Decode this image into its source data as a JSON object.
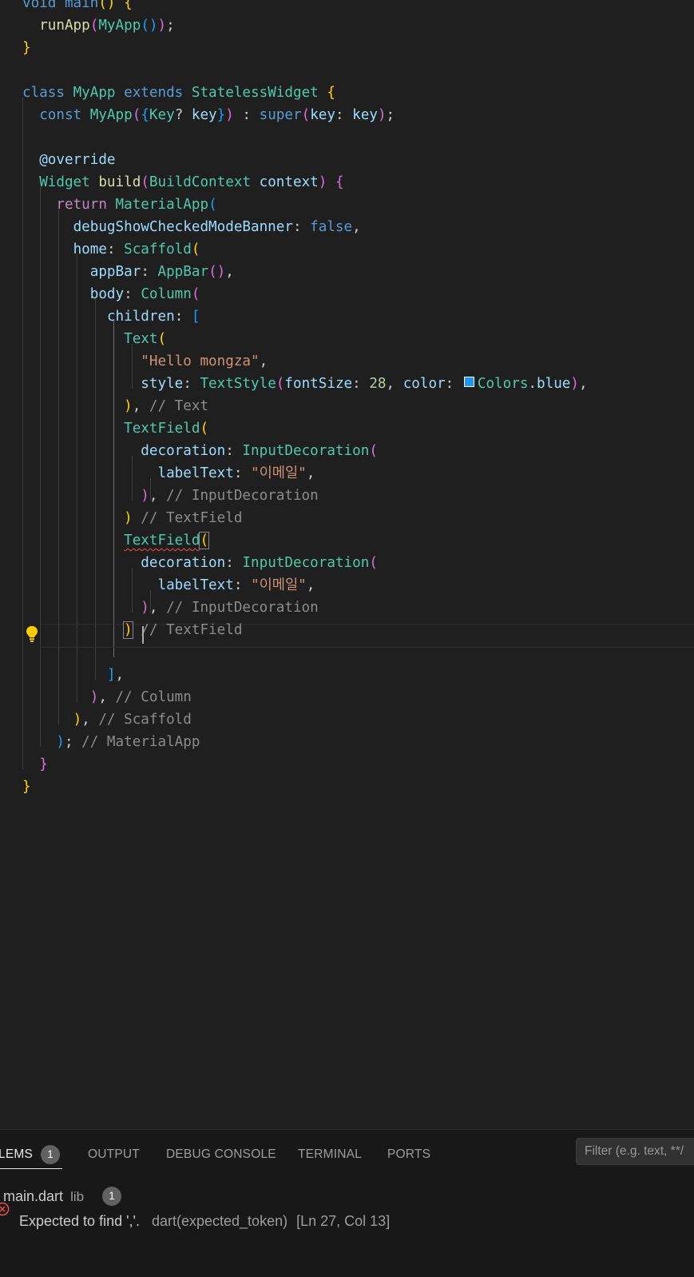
{
  "editor": {
    "lines": [
      [
        {
          "t": "void main",
          "c": "k"
        },
        {
          "t": "() ",
          "c": "b1"
        },
        {
          "t": "{",
          "c": "b1"
        }
      ],
      [
        {
          "t": "  "
        },
        {
          "t": "runApp",
          "c": "f"
        },
        {
          "t": "(",
          "c": "b2"
        },
        {
          "t": "MyApp",
          "c": "t"
        },
        {
          "t": "()",
          "c": "b3"
        },
        {
          "t": ")",
          "c": "b2"
        },
        {
          "t": ";",
          "c": "p"
        }
      ],
      [
        {
          "t": "}",
          "c": "b1"
        }
      ],
      [],
      [
        {
          "t": "class ",
          "c": "k"
        },
        {
          "t": "MyApp ",
          "c": "t"
        },
        {
          "t": "extends ",
          "c": "k"
        },
        {
          "t": "StatelessWidget ",
          "c": "t"
        },
        {
          "t": "{",
          "c": "b1"
        }
      ],
      [
        {
          "t": "  "
        },
        {
          "t": "const ",
          "c": "k"
        },
        {
          "t": "MyApp",
          "c": "t"
        },
        {
          "t": "(",
          "c": "b2"
        },
        {
          "t": "{",
          "c": "b3"
        },
        {
          "t": "Key",
          "c": "t"
        },
        {
          "t": "? ",
          "c": "p"
        },
        {
          "t": "key",
          "c": "v"
        },
        {
          "t": "}",
          "c": "b3"
        },
        {
          "t": ")",
          "c": "b2"
        },
        {
          "t": " : ",
          "c": "p"
        },
        {
          "t": "super",
          "c": "k"
        },
        {
          "t": "(",
          "c": "b2"
        },
        {
          "t": "key",
          "c": "v"
        },
        {
          "t": ": ",
          "c": "p"
        },
        {
          "t": "key",
          "c": "v"
        },
        {
          "t": ")",
          "c": "b2"
        },
        {
          "t": ";",
          "c": "p"
        }
      ],
      [],
      [
        {
          "t": "  "
        },
        {
          "t": "@override",
          "c": "v"
        }
      ],
      [
        {
          "t": "  "
        },
        {
          "t": "Widget ",
          "c": "t"
        },
        {
          "t": "build",
          "c": "f"
        },
        {
          "t": "(",
          "c": "b2"
        },
        {
          "t": "BuildContext ",
          "c": "t"
        },
        {
          "t": "context",
          "c": "v"
        },
        {
          "t": ") ",
          "c": "b2"
        },
        {
          "t": "{",
          "c": "b2"
        }
      ],
      [
        {
          "t": "    "
        },
        {
          "t": "return ",
          "c": "c"
        },
        {
          "t": "MaterialApp",
          "c": "t"
        },
        {
          "t": "(",
          "c": "b3"
        }
      ],
      [
        {
          "t": "      "
        },
        {
          "t": "debugShowCheckedModeBanner",
          "c": "v"
        },
        {
          "t": ": ",
          "c": "p"
        },
        {
          "t": "false",
          "c": "k"
        },
        {
          "t": ",",
          "c": "p"
        }
      ],
      [
        {
          "t": "      "
        },
        {
          "t": "home",
          "c": "v"
        },
        {
          "t": ": ",
          "c": "p"
        },
        {
          "t": "Scaffold",
          "c": "t"
        },
        {
          "t": "(",
          "c": "b1"
        }
      ],
      [
        {
          "t": "        "
        },
        {
          "t": "appBar",
          "c": "v"
        },
        {
          "t": ": ",
          "c": "p"
        },
        {
          "t": "AppBar",
          "c": "t"
        },
        {
          "t": "()",
          "c": "b2"
        },
        {
          "t": ",",
          "c": "p"
        }
      ],
      [
        {
          "t": "        "
        },
        {
          "t": "body",
          "c": "v"
        },
        {
          "t": ": ",
          "c": "p"
        },
        {
          "t": "Column",
          "c": "t"
        },
        {
          "t": "(",
          "c": "b2"
        }
      ],
      [
        {
          "t": "          "
        },
        {
          "t": "children",
          "c": "v"
        },
        {
          "t": ": ",
          "c": "p"
        },
        {
          "t": "[",
          "c": "b3"
        }
      ],
      [
        {
          "t": "            "
        },
        {
          "t": "Text",
          "c": "t"
        },
        {
          "t": "(",
          "c": "b1"
        }
      ],
      [
        {
          "t": "              "
        },
        {
          "t": "\"Hello mongza\"",
          "c": "s"
        },
        {
          "t": ",",
          "c": "p"
        }
      ],
      [
        {
          "t": "              "
        },
        {
          "t": "style",
          "c": "v"
        },
        {
          "t": ": ",
          "c": "p"
        },
        {
          "t": "TextStyle",
          "c": "t"
        },
        {
          "t": "(",
          "c": "b2"
        },
        {
          "t": "fontSize",
          "c": "v"
        },
        {
          "t": ": ",
          "c": "p"
        },
        {
          "t": "28",
          "c": "n"
        },
        {
          "t": ", ",
          "c": "p"
        },
        {
          "t": "color",
          "c": "v"
        },
        {
          "t": ": ",
          "c": "p"
        },
        {
          "t": "",
          "swatch": true
        },
        {
          "t": "Colors",
          "c": "t"
        },
        {
          "t": ".",
          "c": "p"
        },
        {
          "t": "blue",
          "c": "v"
        },
        {
          "t": ")",
          "c": "b2"
        },
        {
          "t": ",",
          "c": "p"
        }
      ],
      [
        {
          "t": "            "
        },
        {
          "t": ")",
          "c": "b1"
        },
        {
          "t": ", ",
          "c": "p"
        },
        {
          "t": "// Text",
          "c": "cm"
        }
      ],
      [
        {
          "t": "            "
        },
        {
          "t": "TextField",
          "c": "t"
        },
        {
          "t": "(",
          "c": "b1"
        }
      ],
      [
        {
          "t": "              "
        },
        {
          "t": "decoration",
          "c": "v"
        },
        {
          "t": ": ",
          "c": "p"
        },
        {
          "t": "InputDecoration",
          "c": "t"
        },
        {
          "t": "(",
          "c": "b2"
        }
      ],
      [
        {
          "t": "                "
        },
        {
          "t": "labelText",
          "c": "v"
        },
        {
          "t": ": ",
          "c": "p"
        },
        {
          "t": "\"이메일\"",
          "c": "s"
        },
        {
          "t": ",",
          "c": "p"
        }
      ],
      [
        {
          "t": "              "
        },
        {
          "t": ")",
          "c": "b2"
        },
        {
          "t": ", ",
          "c": "p"
        },
        {
          "t": "// InputDecoration",
          "c": "cm"
        }
      ],
      [
        {
          "t": "            "
        },
        {
          "t": ")",
          "c": "b1"
        },
        {
          "t": " "
        },
        {
          "t": "// TextField",
          "c": "cm"
        }
      ],
      [
        {
          "t": "            "
        },
        {
          "t": "TextField",
          "c": "t",
          "sq": true
        },
        {
          "t": "(",
          "c": "b1",
          "bm": true
        }
      ],
      [
        {
          "t": "              "
        },
        {
          "t": "decoration",
          "c": "v"
        },
        {
          "t": ": ",
          "c": "p"
        },
        {
          "t": "InputDecoration",
          "c": "t"
        },
        {
          "t": "(",
          "c": "b2"
        }
      ],
      [
        {
          "t": "                "
        },
        {
          "t": "labelText",
          "c": "v"
        },
        {
          "t": ": ",
          "c": "p"
        },
        {
          "t": "\"이메일\"",
          "c": "s"
        },
        {
          "t": ",",
          "c": "p"
        }
      ],
      [
        {
          "t": "              "
        },
        {
          "t": ")",
          "c": "b2"
        },
        {
          "t": ", ",
          "c": "p"
        },
        {
          "t": "// InputDecoration",
          "c": "cm"
        }
      ],
      [
        {
          "t": "            "
        },
        {
          "t": ")",
          "c": "b1",
          "bm": true
        },
        {
          "t": " "
        },
        {
          "t": "// TextField",
          "c": "cm"
        }
      ],
      [],
      [
        {
          "t": "          "
        },
        {
          "t": "]",
          "c": "b3"
        },
        {
          "t": ",",
          "c": "p"
        }
      ],
      [
        {
          "t": "        "
        },
        {
          "t": ")",
          "c": "b2"
        },
        {
          "t": ", ",
          "c": "p"
        },
        {
          "t": "// Column",
          "c": "cm"
        }
      ],
      [
        {
          "t": "      "
        },
        {
          "t": ")",
          "c": "b1"
        },
        {
          "t": ", ",
          "c": "p"
        },
        {
          "t": "// Scaffold",
          "c": "cm"
        }
      ],
      [
        {
          "t": "    "
        },
        {
          "t": ")",
          "c": "b3"
        },
        {
          "t": "; ",
          "c": "p"
        },
        {
          "t": "// MaterialApp",
          "c": "cm"
        }
      ],
      [
        {
          "t": "  "
        },
        {
          "t": "}",
          "c": "b2"
        }
      ],
      [
        {
          "t": "}",
          "c": "b1"
        }
      ]
    ]
  },
  "panel": {
    "tabs": {
      "problems": "LEMS",
      "problems_count": "1",
      "output": "OUTPUT",
      "debug_console": "DEBUG CONSOLE",
      "terminal": "TERMINAL",
      "ports": "PORTS"
    },
    "filter_placeholder": "Filter (e.g. text, **/",
    "file": {
      "name": "main.dart",
      "folder": "lib",
      "count": "1"
    },
    "problem": {
      "message": "Expected to find ','.",
      "source": "dart(expected_token)",
      "location": "[Ln 27, Col 13]"
    }
  },
  "colors": {
    "editor_bg": "#1f1f1f",
    "panel_bg": "#181818",
    "error": "#f14c4c",
    "lightbulb": "#ffcc00"
  }
}
